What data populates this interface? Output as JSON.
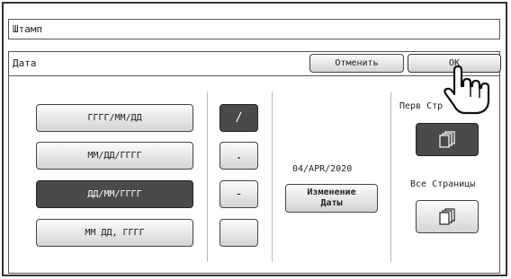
{
  "window": {
    "title": "Штамп"
  },
  "header": {
    "title": "Дата",
    "cancel_label": "Отменить",
    "ok_label": "OK"
  },
  "formats": [
    {
      "label": "ГГГГ/ММ/ДД",
      "selected": false
    },
    {
      "label": "ММ/ДД/ГГГГ",
      "selected": false
    },
    {
      "label": "ДД/ММ/ГГГГ",
      "selected": true
    },
    {
      "label": "ММ ДД, ГГГГ",
      "selected": false
    }
  ],
  "separators": [
    {
      "label": "/",
      "selected": true
    },
    {
      "label": ".",
      "selected": false
    },
    {
      "label": "-",
      "selected": false
    },
    {
      "label": "",
      "selected": false
    }
  ],
  "date": {
    "value": "04/APR/2020",
    "change_label_line1": "Изменение",
    "change_label_line2": "Даты"
  },
  "pages": {
    "first_page_label": "Перв Стр",
    "all_pages_label": "Все Страницы"
  },
  "icons": {
    "pointer": "hand-pointer-icon",
    "pages": "pages-icon"
  },
  "colors": {
    "selected": "#4a4a4a",
    "button_top": "#fbfbfb",
    "button_bottom": "#d4d4d4"
  }
}
